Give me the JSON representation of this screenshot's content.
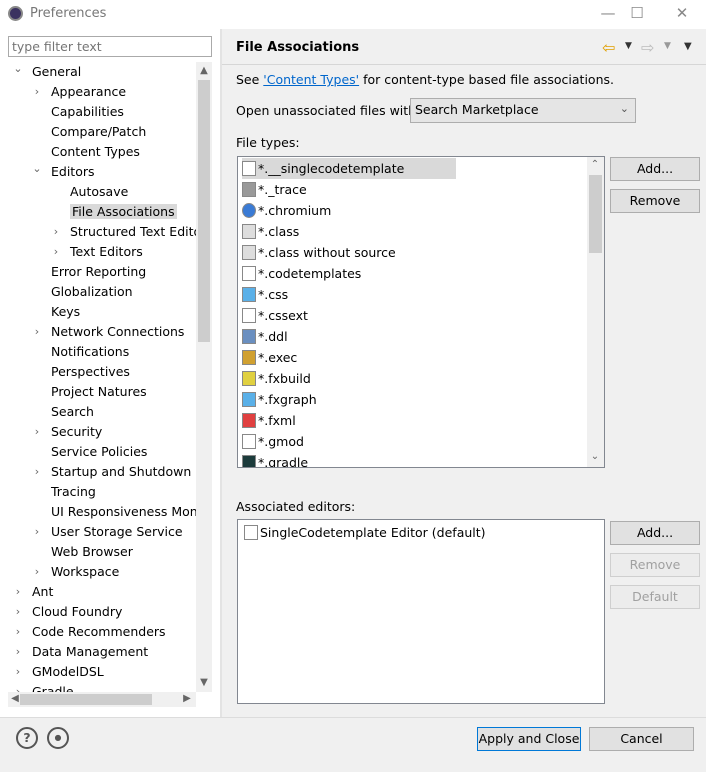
{
  "window": {
    "title": "Preferences",
    "minimize": "—",
    "maximize": "☐",
    "close": "✕"
  },
  "filter": {
    "placeholder": "type filter text"
  },
  "tree": [
    {
      "label": "General",
      "level": 0,
      "chev": "v"
    },
    {
      "label": "Appearance",
      "level": 1,
      "chev": ">"
    },
    {
      "label": "Capabilities",
      "level": 1
    },
    {
      "label": "Compare/Patch",
      "level": 1
    },
    {
      "label": "Content Types",
      "level": 1
    },
    {
      "label": "Editors",
      "level": 1,
      "chev": "v"
    },
    {
      "label": "Autosave",
      "level": 2
    },
    {
      "label": "File Associations",
      "level": 2,
      "selected": true
    },
    {
      "label": "Structured Text Editors",
      "level": 2,
      "chev": ">"
    },
    {
      "label": "Text Editors",
      "level": 2,
      "chev": ">"
    },
    {
      "label": "Error Reporting",
      "level": 1
    },
    {
      "label": "Globalization",
      "level": 1
    },
    {
      "label": "Keys",
      "level": 1
    },
    {
      "label": "Network Connections",
      "level": 1,
      "chev": ">"
    },
    {
      "label": "Notifications",
      "level": 1
    },
    {
      "label": "Perspectives",
      "level": 1
    },
    {
      "label": "Project Natures",
      "level": 1
    },
    {
      "label": "Search",
      "level": 1
    },
    {
      "label": "Security",
      "level": 1,
      "chev": ">"
    },
    {
      "label": "Service Policies",
      "level": 1
    },
    {
      "label": "Startup and Shutdown",
      "level": 1,
      "chev": ">"
    },
    {
      "label": "Tracing",
      "level": 1
    },
    {
      "label": "UI Responsiveness Monitoring",
      "level": 1
    },
    {
      "label": "User Storage Service",
      "level": 1,
      "chev": ">"
    },
    {
      "label": "Web Browser",
      "level": 1
    },
    {
      "label": "Workspace",
      "level": 1,
      "chev": ">"
    },
    {
      "label": "Ant",
      "level": 0,
      "chev": ">"
    },
    {
      "label": "Cloud Foundry",
      "level": 0,
      "chev": ">"
    },
    {
      "label": "Code Recommenders",
      "level": 0,
      "chev": ">"
    },
    {
      "label": "Data Management",
      "level": 0,
      "chev": ">"
    },
    {
      "label": "GModelDSL",
      "level": 0,
      "chev": ">"
    },
    {
      "label": "Gradle",
      "level": 0,
      "chev": ">"
    }
  ],
  "page": {
    "title": "File Associations",
    "see_prefix": "See ",
    "see_link": "'Content Types'",
    "see_suffix": " for content-type based file associations.",
    "open_label": "Open unassociated files with:",
    "open_value": "Search Marketplace",
    "file_types_label": "File types:",
    "file_types": [
      {
        "name": "*.__singlecodetemplate",
        "icon": "text-file",
        "selected": true
      },
      {
        "name": "*._trace",
        "icon": "trace"
      },
      {
        "name": "*.chromium",
        "icon": "chromium"
      },
      {
        "name": "*.class",
        "icon": "class-file"
      },
      {
        "name": "*.class without source",
        "icon": "class-file"
      },
      {
        "name": "*.codetemplates",
        "icon": "text-file"
      },
      {
        "name": "*.css",
        "icon": "css"
      },
      {
        "name": "*.cssext",
        "icon": "text-file"
      },
      {
        "name": "*.ddl",
        "icon": "ddl"
      },
      {
        "name": "*.exec",
        "icon": "gears"
      },
      {
        "name": "*.fxbuild",
        "icon": "fxbuild"
      },
      {
        "name": "*.fxgraph",
        "icon": "fxgraph"
      },
      {
        "name": "*.fxml",
        "icon": "fxml"
      },
      {
        "name": "*.gmod",
        "icon": "text-file"
      },
      {
        "name": "*.gradle",
        "icon": "gradle"
      }
    ],
    "add": "Add...",
    "remove": "Remove",
    "default": "Default",
    "editors_label": "Associated editors:",
    "editors": [
      {
        "name": "SingleCodetemplate Editor (default)",
        "icon": "text-file"
      }
    ]
  },
  "footer": {
    "apply_close": "Apply and Close",
    "cancel": "Cancel"
  },
  "colors": {
    "link": "#0066cc",
    "selection": "#d9d9d9"
  }
}
